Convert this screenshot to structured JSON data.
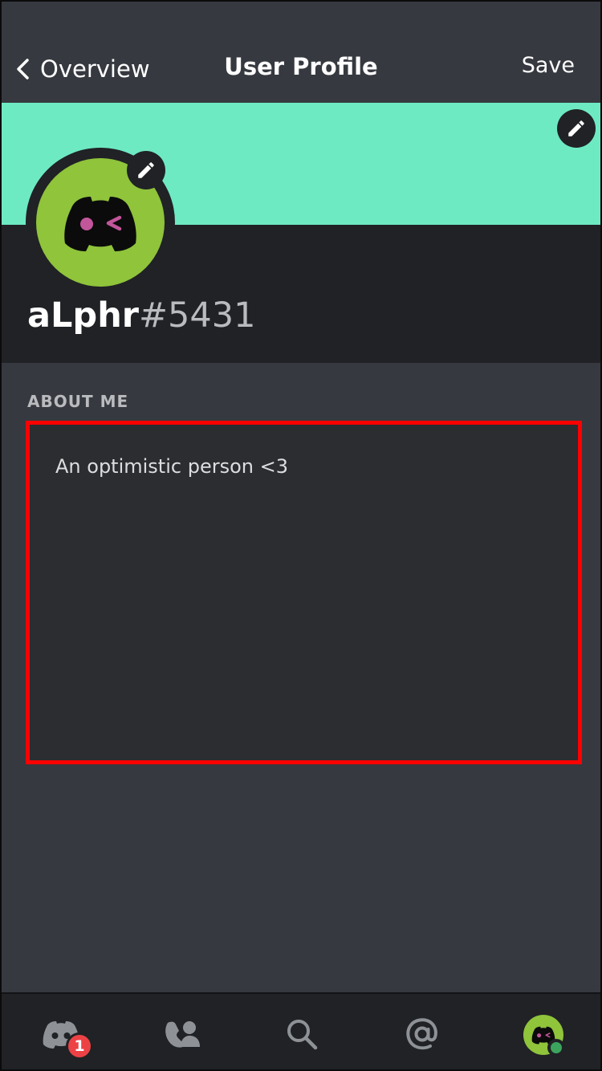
{
  "header": {
    "back_label": "Overview",
    "title": "User Profile",
    "save_label": "Save"
  },
  "profile": {
    "username": "aLphr",
    "discriminator": "#5431",
    "banner_color": "#6eeac3",
    "avatar_color": "#8fc43b"
  },
  "about": {
    "label": "ABOUT ME",
    "text": "An optimistic person <3"
  },
  "bottom_nav": {
    "items": [
      {
        "icon": "discord-home-icon",
        "badge": "1"
      },
      {
        "icon": "friends-icon"
      },
      {
        "icon": "search-icon"
      },
      {
        "icon": "mentions-icon"
      },
      {
        "icon": "profile-avatar-icon",
        "status": "online"
      }
    ]
  },
  "colors": {
    "accent_red": "#ff0000",
    "badge_red": "#ed4245",
    "online_green": "#3ba55d"
  }
}
